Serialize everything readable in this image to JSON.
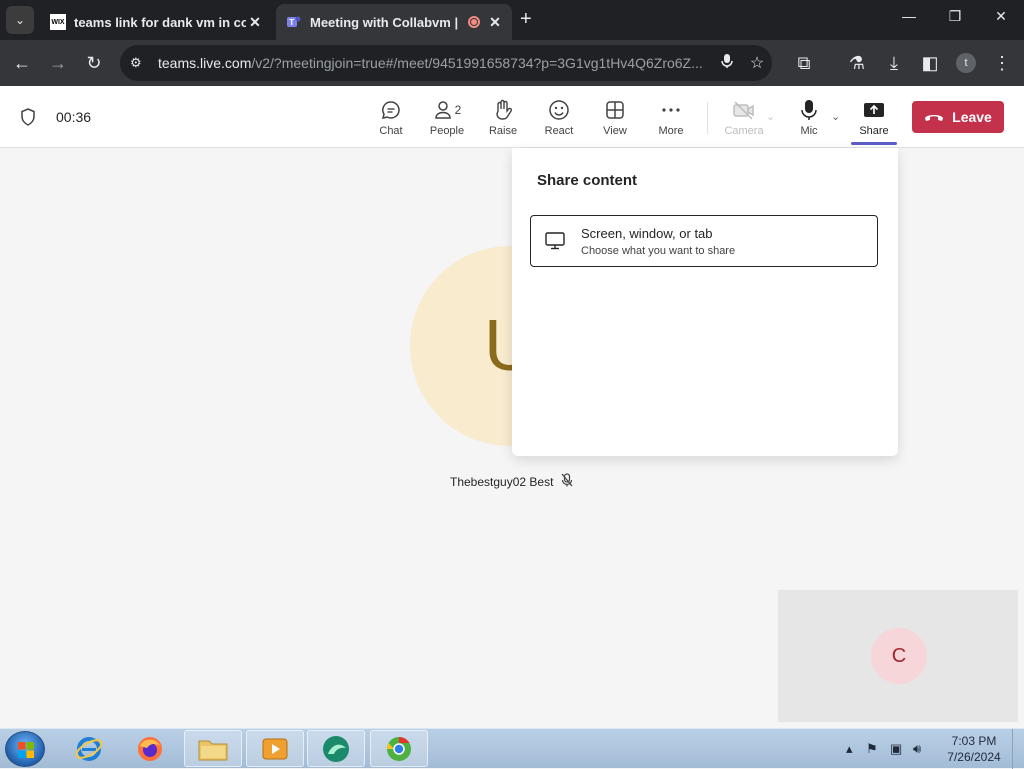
{
  "browser": {
    "tabs": [
      {
        "title": "teams link for dank vm in comments",
        "favicon": "WIX",
        "active": false
      },
      {
        "title": "Meeting with Collabvm | M",
        "favicon": "teams-icon",
        "active": true,
        "recording": true
      }
    ],
    "url_main": "teams.live.com",
    "url_rest": "/v2/?meetingjoin=true#/meet/9451991658734?p=3G1vg1tHv4Q6Zro6Z...",
    "profile_initial": "t"
  },
  "meeting": {
    "timer": "00:36",
    "controls": [
      {
        "label": "Chat",
        "icon": "chat-icon"
      },
      {
        "label": "People",
        "icon": "people-icon",
        "count": "2"
      },
      {
        "label": "Raise",
        "icon": "hand-icon"
      },
      {
        "label": "React",
        "icon": "smiley-icon"
      },
      {
        "label": "View",
        "icon": "grid-icon"
      },
      {
        "label": "More",
        "icon": "more-icon"
      },
      {
        "label": "Camera",
        "icon": "camera-off-icon",
        "disabled": true
      },
      {
        "label": "Mic",
        "icon": "mic-icon"
      },
      {
        "label": "Share",
        "icon": "share-icon",
        "active": true
      }
    ],
    "leave_label": "Leave",
    "accent": "#5b5fc7",
    "leave_color": "#c4314b"
  },
  "stage": {
    "participant_initial": "U",
    "participant_name": "Thebestguy02 Best",
    "self_initial": "C"
  },
  "share_panel": {
    "title": "Share content",
    "option_title": "Screen, window, or tab",
    "option_subtitle": "Choose what you want to share"
  },
  "taskbar": {
    "time": "7:03 PM",
    "date": "7/26/2024"
  }
}
